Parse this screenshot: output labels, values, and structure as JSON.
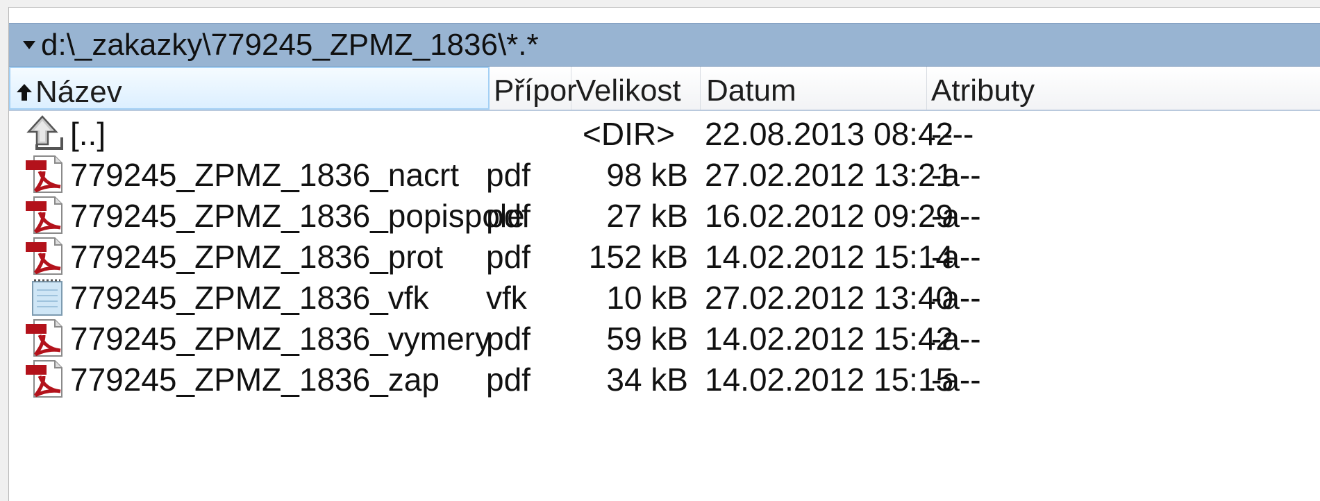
{
  "path_bar": {
    "path": "d:\\_zakazky\\779245_ZPMZ_1836\\*.*"
  },
  "columns": [
    {
      "label": "Název",
      "sorted": true
    },
    {
      "label": "Přípor"
    },
    {
      "label": "Velikost"
    },
    {
      "label": "Datum"
    },
    {
      "label": "Atributy"
    }
  ],
  "files": [
    {
      "icon": "parent-folder-icon",
      "name": "[..]",
      "ext": "",
      "size": "<DIR>",
      "date": "22.08.2013 08:42",
      "attrs": "----"
    },
    {
      "icon": "pdf-icon",
      "name": "779245_ZPMZ_1836_nacrt",
      "ext": "pdf",
      "size": "98 kB",
      "date": "27.02.2012 13:21",
      "attrs": "-a--"
    },
    {
      "icon": "pdf-icon",
      "name": "779245_ZPMZ_1836_popispole",
      "ext": "pdf",
      "size": "27 kB",
      "date": "16.02.2012 09:29",
      "attrs": "-a--"
    },
    {
      "icon": "pdf-icon",
      "name": "779245_ZPMZ_1836_prot",
      "ext": "pdf",
      "size": "152 kB",
      "date": "14.02.2012 15:14",
      "attrs": "-a--"
    },
    {
      "icon": "notepad-icon",
      "name": "779245_ZPMZ_1836_vfk",
      "ext": "vfk",
      "size": "10 kB",
      "date": "27.02.2012 13:40",
      "attrs": "-a--"
    },
    {
      "icon": "pdf-icon",
      "name": "779245_ZPMZ_1836_vymery",
      "ext": "pdf",
      "size": "59 kB",
      "date": "14.02.2012 15:42",
      "attrs": "-a--"
    },
    {
      "icon": "pdf-icon",
      "name": "779245_ZPMZ_1836_zap",
      "ext": "pdf",
      "size": "34 kB",
      "date": "14.02.2012 15:15",
      "attrs": "-a--"
    }
  ],
  "colors": {
    "path_bar_bg": "#98b4d2",
    "sorted_header_bg": "#dcefff",
    "pdf_red": "#b3121b"
  }
}
